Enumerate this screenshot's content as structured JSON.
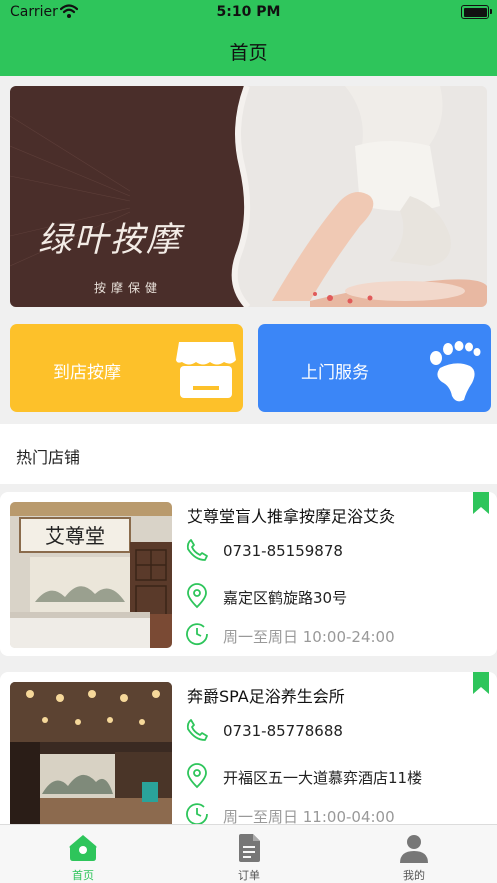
{
  "status_bar": {
    "carrier": "Carrier",
    "time": "5:10 PM"
  },
  "nav": {
    "title": "首页"
  },
  "banner": {
    "title": "绿叶按摩",
    "subtitle": "按摩保健"
  },
  "entries": [
    {
      "label": "到店按摩",
      "icon": "storefront-icon",
      "color": "#fdc12a"
    },
    {
      "label": "上门服务",
      "icon": "footprint-icon",
      "color": "#3b86f7"
    }
  ],
  "section": {
    "title": "热门店铺"
  },
  "shops": [
    {
      "name": "艾尊堂盲人推拿按摩足浴艾灸",
      "phone": "0731-85159878",
      "address": "嘉定区鹤旋路30号",
      "hours": "周一至周日 10:00-24:00",
      "sign_text": "艾尊堂"
    },
    {
      "name": "奔爵SPA足浴养生会所",
      "phone": "0731-85778688",
      "address": "开福区五一大道慕弈酒店11楼",
      "hours": "周一至周日 11:00-04:00"
    }
  ],
  "tabs": [
    {
      "label": "首页",
      "icon": "home-icon",
      "active": true
    },
    {
      "label": "订单",
      "icon": "document-icon",
      "active": false
    },
    {
      "label": "我的",
      "icon": "user-icon",
      "active": false
    }
  ],
  "colors": {
    "brand_green": "#2ec55b",
    "muted_text": "#999999"
  }
}
